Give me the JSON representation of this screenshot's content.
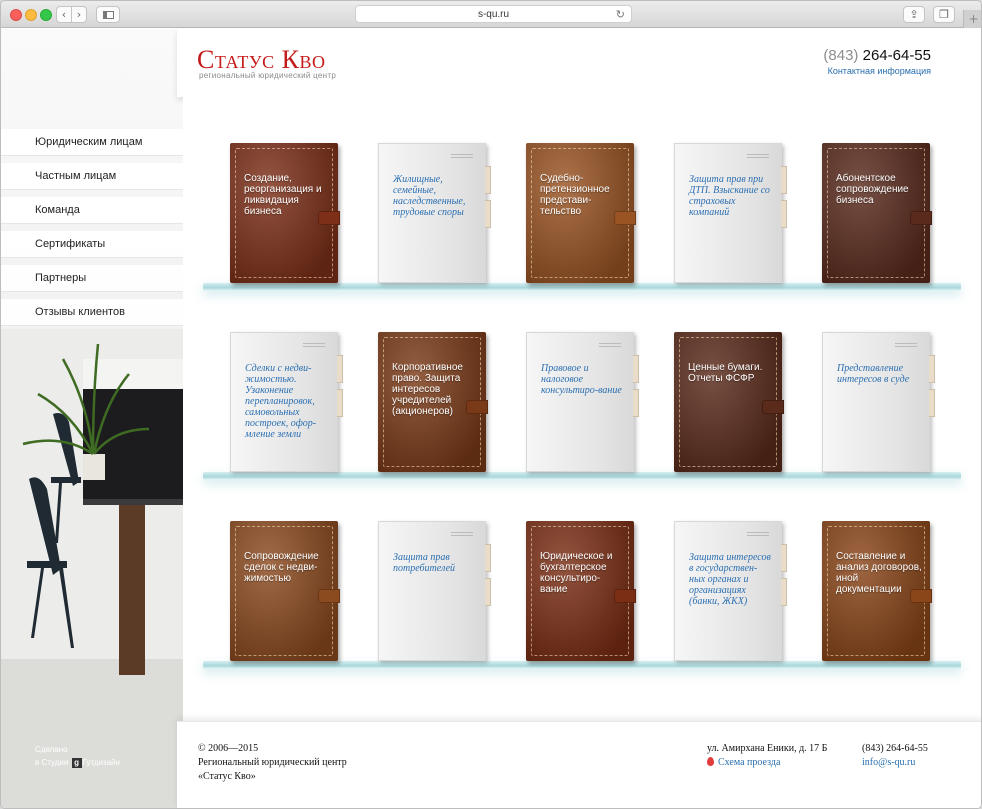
{
  "browser": {
    "url": "s-qu.ru"
  },
  "header": {
    "logo_title": "Статус Кво",
    "logo_subtitle": "региональный юридический центр",
    "phone_code": "(843)",
    "phone_number": "264-64-55",
    "contact_link": "Контактная информация"
  },
  "sidebar": {
    "items": [
      {
        "label": "Юридическим лицам"
      },
      {
        "label": "Частным лицам"
      },
      {
        "label": "Команда"
      },
      {
        "label": "Сертификаты"
      },
      {
        "label": "Партнеры"
      },
      {
        "label": "Отзывы клиентов"
      }
    ],
    "credit_line1": "Сделано",
    "credit_line2a": "в Студии",
    "credit_logo": "g",
    "credit_line2b": "Гутдизайн"
  },
  "shelves": [
    [
      {
        "style": "leather",
        "color": "#7d2f18",
        "text": "Создание, реорганизация и ликвидация бизнеса"
      },
      {
        "style": "paper",
        "text": "Жилищные, семейные, наследственные, трудовые споры"
      },
      {
        "style": "leather",
        "color": "#9a5423",
        "text": "Судебно-претензионное представи-тельство"
      },
      {
        "style": "paper",
        "text": "Защита прав при ДТП. Взыскание со страховых компаний"
      },
      {
        "style": "leather",
        "color": "#5a2a1c",
        "text": "Абонентское сопровождение бизнеса"
      }
    ],
    [
      {
        "style": "paper",
        "text": "Сделки с недви-жимостью. Узаконение перепланировок, самовольных построек, офор-мление земли"
      },
      {
        "style": "leather",
        "color": "#7b3a17",
        "text": "Корпоративное право. Защита интересов учредителей (акционеров)"
      },
      {
        "style": "paper",
        "text": "Правовое и налоговое консультиро-вание"
      },
      {
        "style": "leather",
        "color": "#5a2a1a",
        "text": "Ценные бумаги. Отчеты ФСФР"
      },
      {
        "style": "paper",
        "text": "Представление интересов в суде"
      }
    ],
    [
      {
        "style": "leather",
        "color": "#8c4a1f",
        "text": "Сопровождение сделок с недви-жимостью"
      },
      {
        "style": "paper",
        "text": "Защита прав потребителей"
      },
      {
        "style": "leather",
        "color": "#7b2e14",
        "text": "Юридическое и бухгалтерское консультиро-вание"
      },
      {
        "style": "paper",
        "text": "Защита интересов в государствен-ных органах и организациях (банки, ЖКХ)"
      },
      {
        "style": "leather",
        "color": "#8a4518",
        "text": "Составление и анализ договоров, иной документации"
      }
    ]
  ],
  "footer": {
    "copyright": "© 2006—2015",
    "org_line1": "Региональный юридический центр",
    "org_line2": "«Статус Кво»",
    "address": "ул. Амирхана Еники, д. 17 Б",
    "map_link": "Схема проезда",
    "phone": "(843) 264-64-55",
    "email": "info@s-qu.ru"
  }
}
